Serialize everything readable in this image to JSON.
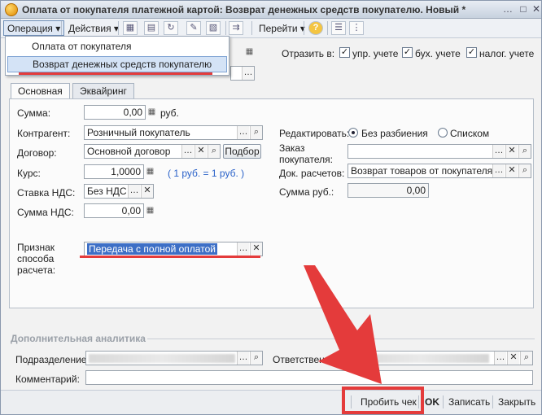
{
  "window": {
    "title": "Оплата от покупателя платежной картой: Возврат денежных средств покупателю. Новый *"
  },
  "toolbar": {
    "operation": "Операция",
    "actions": "Действия",
    "goto": "Перейти",
    "help": "?"
  },
  "operation_menu": {
    "items": [
      "Оплата от покупателя",
      "Возврат денежных средств покупателю"
    ],
    "selected_index": 1
  },
  "reflect": {
    "label": "Отразить в:",
    "checks": [
      {
        "label": "упр. учете",
        "checked": "✓"
      },
      {
        "label": "бух. учете",
        "checked": "✓"
      },
      {
        "label": "налог. учете",
        "checked": "✓"
      }
    ]
  },
  "tabs": [
    "Основная",
    "Эквайринг"
  ],
  "form": {
    "sum_label": "Сумма:",
    "sum_value": "0,00",
    "currency": "руб.",
    "contractor_label": "Контрагент:",
    "contractor_value": "Розничный покупатель",
    "contract_label": "Договор:",
    "contract_value": "Основной договор",
    "select_button": "Подбор",
    "rate_label": "Курс:",
    "rate_value": "1,0000",
    "rate_hint": "( 1 руб. = 1 руб. )",
    "vat_rate_label": "Ставка НДС:",
    "vat_rate_value": "Без НДС",
    "vat_sum_label": "Сумма НДС:",
    "vat_sum_value": "0,00",
    "payment_method_label": "Признак способа расчета:",
    "payment_method_value": "Передача с полной оплатой",
    "edit_label": "Редактировать:",
    "edit_option_1": "Без разбиения",
    "edit_option_2": "Списком",
    "order_label": "Заказ покупателя:",
    "order_value": "",
    "doc_label": "Док. расчетов:",
    "doc_value": "Возврат товаров от покупателя Т",
    "sum_rub_label": "Сумма руб.:",
    "sum_rub_value": "0,00"
  },
  "extra": {
    "section_title": "Дополнительная аналитика",
    "division_label": "Подразделение:",
    "responsible_label": "Ответственный:",
    "comment_label": "Комментарий:"
  },
  "bottom": {
    "print_check": "Пробить чек",
    "ok": "OK",
    "save": "Записать",
    "close": "Закрыть"
  },
  "colors": {
    "highlight_red": "#e43b3b",
    "selection_blue": "#3d6fc6"
  }
}
